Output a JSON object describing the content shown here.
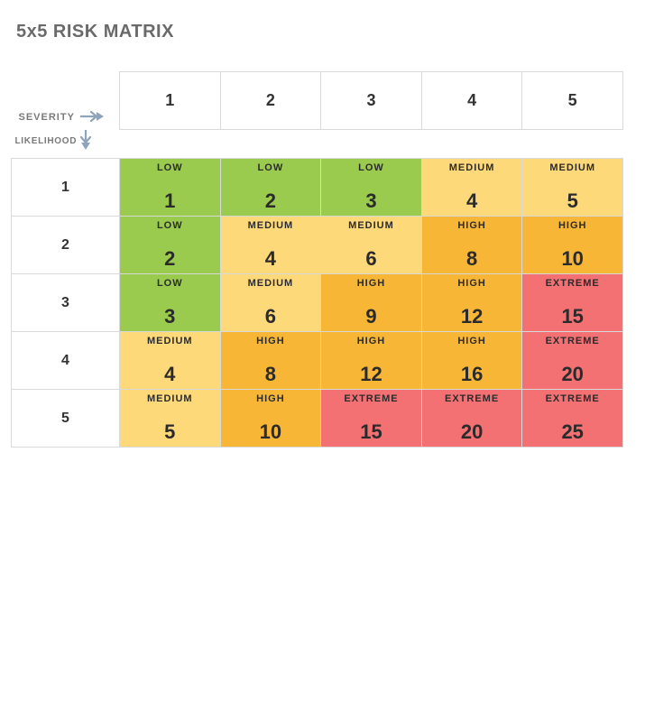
{
  "title": "5x5 RISK MATRIX",
  "axes": {
    "severity_label": "SEVERITY",
    "likelihood_label": "LIKELIHOOD"
  },
  "severity_headers": [
    "1",
    "2",
    "3",
    "4",
    "5"
  ],
  "likelihood_headers": [
    "1",
    "2",
    "3",
    "4",
    "5"
  ],
  "risk_labels": {
    "low": "LOW",
    "medium": "MEDIUM",
    "high": "HIGH",
    "extreme": "EXTREME"
  },
  "colors": {
    "low": "#9acb4f",
    "medium": "#fed979",
    "high": "#f8b637",
    "extreme": "#f37073"
  },
  "cells": [
    [
      {
        "level": "low",
        "value": "1"
      },
      {
        "level": "low",
        "value": "2"
      },
      {
        "level": "low",
        "value": "3"
      },
      {
        "level": "medium",
        "value": "4"
      },
      {
        "level": "medium",
        "value": "5"
      }
    ],
    [
      {
        "level": "low",
        "value": "2"
      },
      {
        "level": "medium",
        "value": "4"
      },
      {
        "level": "medium",
        "value": "6"
      },
      {
        "level": "high",
        "value": "8"
      },
      {
        "level": "high",
        "value": "10"
      }
    ],
    [
      {
        "level": "low",
        "value": "3"
      },
      {
        "level": "medium",
        "value": "6"
      },
      {
        "level": "high",
        "value": "9"
      },
      {
        "level": "high",
        "value": "12"
      },
      {
        "level": "extreme",
        "value": "15"
      }
    ],
    [
      {
        "level": "medium",
        "value": "4"
      },
      {
        "level": "high",
        "value": "8"
      },
      {
        "level": "high",
        "value": "12"
      },
      {
        "level": "high",
        "value": "16"
      },
      {
        "level": "extreme",
        "value": "20"
      }
    ],
    [
      {
        "level": "medium",
        "value": "5"
      },
      {
        "level": "high",
        "value": "10"
      },
      {
        "level": "extreme",
        "value": "15"
      },
      {
        "level": "extreme",
        "value": "20"
      },
      {
        "level": "extreme",
        "value": "25"
      }
    ]
  ],
  "chart_data": {
    "type": "heatmap",
    "title": "5x5 RISK MATRIX",
    "xlabel": "SEVERITY",
    "ylabel": "LIKELIHOOD",
    "x_categories": [
      "1",
      "2",
      "3",
      "4",
      "5"
    ],
    "y_categories": [
      "1",
      "2",
      "3",
      "4",
      "5"
    ],
    "values": [
      [
        1,
        2,
        3,
        4,
        5
      ],
      [
        2,
        4,
        6,
        8,
        10
      ],
      [
        3,
        6,
        9,
        12,
        15
      ],
      [
        4,
        8,
        12,
        16,
        20
      ],
      [
        5,
        10,
        15,
        20,
        25
      ]
    ],
    "levels": [
      [
        "LOW",
        "LOW",
        "LOW",
        "MEDIUM",
        "MEDIUM"
      ],
      [
        "LOW",
        "MEDIUM",
        "MEDIUM",
        "HIGH",
        "HIGH"
      ],
      [
        "LOW",
        "MEDIUM",
        "HIGH",
        "HIGH",
        "EXTREME"
      ],
      [
        "MEDIUM",
        "HIGH",
        "HIGH",
        "HIGH",
        "EXTREME"
      ],
      [
        "MEDIUM",
        "HIGH",
        "EXTREME",
        "EXTREME",
        "EXTREME"
      ]
    ],
    "legend": [
      {
        "label": "LOW",
        "color": "#9acb4f"
      },
      {
        "label": "MEDIUM",
        "color": "#fed979"
      },
      {
        "label": "HIGH",
        "color": "#f8b637"
      },
      {
        "label": "EXTREME",
        "color": "#f37073"
      }
    ]
  }
}
